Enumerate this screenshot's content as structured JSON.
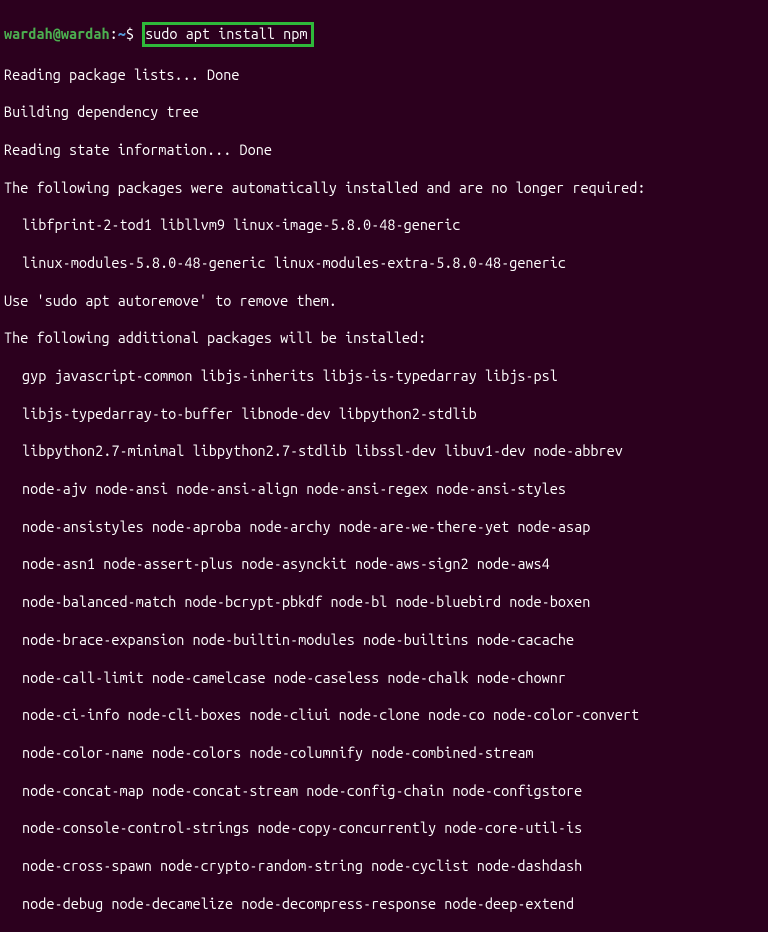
{
  "prompt": {
    "user": "wardah@wardah",
    "colon": ":",
    "tilde": "~",
    "dollar": "$ "
  },
  "command": "sudo apt install npm",
  "lines": {
    "l1": "Reading package lists... Done",
    "l2": "Building dependency tree",
    "l3": "Reading state information... Done",
    "l4": "The following packages were automatically installed and are no longer required:",
    "l5": "libfprint-2-tod1 libllvm9 linux-image-5.8.0-48-generic",
    "l6": "linux-modules-5.8.0-48-generic linux-modules-extra-5.8.0-48-generic",
    "l7": "Use 'sudo apt autoremove' to remove them.",
    "l8": "The following additional packages will be installed:",
    "l9": "gyp javascript-common libjs-inherits libjs-is-typedarray libjs-psl",
    "l10": "libjs-typedarray-to-buffer libnode-dev libpython2-stdlib",
    "l11": "libpython2.7-minimal libpython2.7-stdlib libssl-dev libuv1-dev node-abbrev",
    "l12": "node-ajv node-ansi node-ansi-align node-ansi-regex node-ansi-styles",
    "l13": "node-ansistyles node-aproba node-archy node-are-we-there-yet node-asap",
    "l14": "node-asn1 node-assert-plus node-asynckit node-aws-sign2 node-aws4",
    "l15": "node-balanced-match node-bcrypt-pbkdf node-bl node-bluebird node-boxen",
    "l16": "node-brace-expansion node-builtin-modules node-builtins node-cacache",
    "l17": "node-call-limit node-camelcase node-caseless node-chalk node-chownr",
    "l18": "node-ci-info node-cli-boxes node-cliui node-clone node-co node-color-convert",
    "l19": "node-color-name node-colors node-columnify node-combined-stream",
    "l20": "node-concat-map node-concat-stream node-config-chain node-configstore",
    "l21": "node-console-control-strings node-copy-concurrently node-core-util-is",
    "l22": "node-cross-spawn node-crypto-random-string node-cyclist node-dashdash",
    "l23": "node-debug node-decamelize node-decompress-response node-deep-extend"
  }
}
